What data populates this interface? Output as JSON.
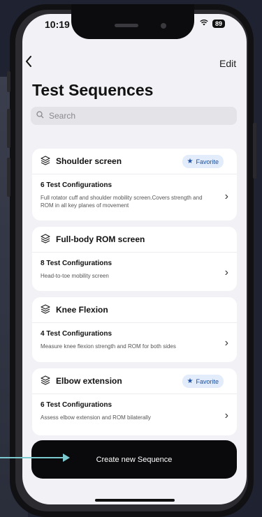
{
  "status": {
    "time": "10:19",
    "battery": "89"
  },
  "nav": {
    "back_icon": "chevron-left-icon",
    "edit_label": "Edit"
  },
  "title": "Test Sequences",
  "search": {
    "placeholder": "Search"
  },
  "sequences": [
    {
      "name": "Shoulder screen",
      "favorite": true,
      "favorite_label": "Favorite",
      "configurations": "6 Test Configurations",
      "description": "Full rotator cuff and shoulder mobility screen.Covers strength and ROM in all key planes of movement"
    },
    {
      "name": "Full-body ROM screen",
      "favorite": false,
      "configurations": "8 Test Configurations",
      "description": "Head-to-toe mobility screen"
    },
    {
      "name": "Knee Flexion",
      "favorite": false,
      "configurations": "4 Test Configurations",
      "description": "Measure knee flexion strength and ROM for both sides"
    },
    {
      "name": "Elbow extension",
      "favorite": true,
      "favorite_label": "Favorite",
      "configurations": "6 Test Configurations",
      "description": "Assess elbow extension and ROM bilaterally"
    }
  ],
  "cta": {
    "label": "Create new Sequence"
  },
  "colors": {
    "accent_favorite_bg": "#e2ecfa",
    "accent_favorite_text": "#1d4fa3",
    "pointer_arrow": "#7cc9cf"
  }
}
